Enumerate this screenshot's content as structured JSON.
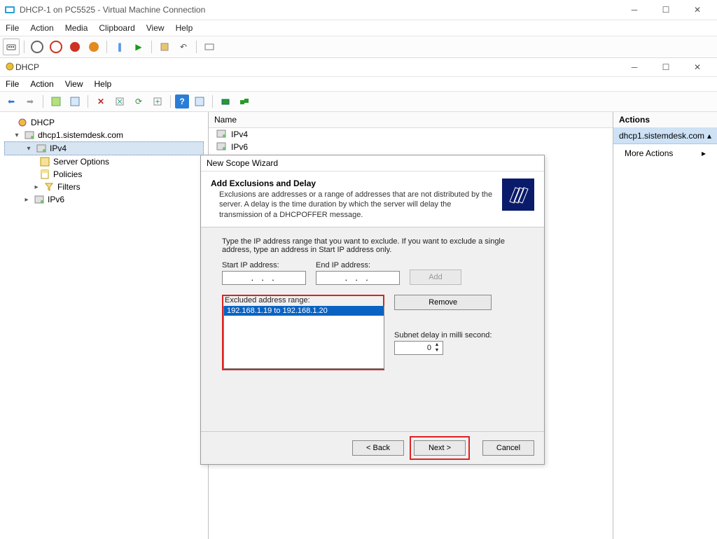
{
  "outer": {
    "title": "DHCP-1 on PC5525 - Virtual Machine Connection",
    "menu": [
      "File",
      "Action",
      "Media",
      "Clipboard",
      "View",
      "Help"
    ]
  },
  "inner": {
    "title": "DHCP",
    "menu": [
      "File",
      "Action",
      "View",
      "Help"
    ]
  },
  "tree": {
    "root": "DHCP",
    "server": "dhcp1.sistemdesk.com",
    "ipv4": "IPv4",
    "ipv6": "IPv6",
    "serverOptions": "Server Options",
    "policies": "Policies",
    "filters": "Filters"
  },
  "nameCol": {
    "header": "Name",
    "items": [
      "IPv4",
      "IPv6"
    ]
  },
  "actions": {
    "header": "Actions",
    "selected": "dhcp1.sistemdesk.com",
    "more": "More Actions"
  },
  "wizard": {
    "title": "New Scope Wizard",
    "heading": "Add Exclusions and Delay",
    "sub": "Exclusions are addresses or a range of addresses that are not distributed by the server. A delay is the time duration by which the server will delay the transmission of a DHCPOFFER message.",
    "rangeHelp": "Type the IP address range that you want to exclude. If you want to exclude a single address, type an address in Start IP address only.",
    "startLabel": "Start IP address:",
    "endLabel": "End IP address:",
    "addBtn": "Add",
    "excludedLabel": "Excluded address range:",
    "excludedItem": "192.168.1.19 to 192.168.1.20",
    "removeBtn": "Remove",
    "delayLabel": "Subnet delay in milli second:",
    "delayVal": "0",
    "back": "< Back",
    "next": "Next >",
    "cancel": "Cancel"
  }
}
